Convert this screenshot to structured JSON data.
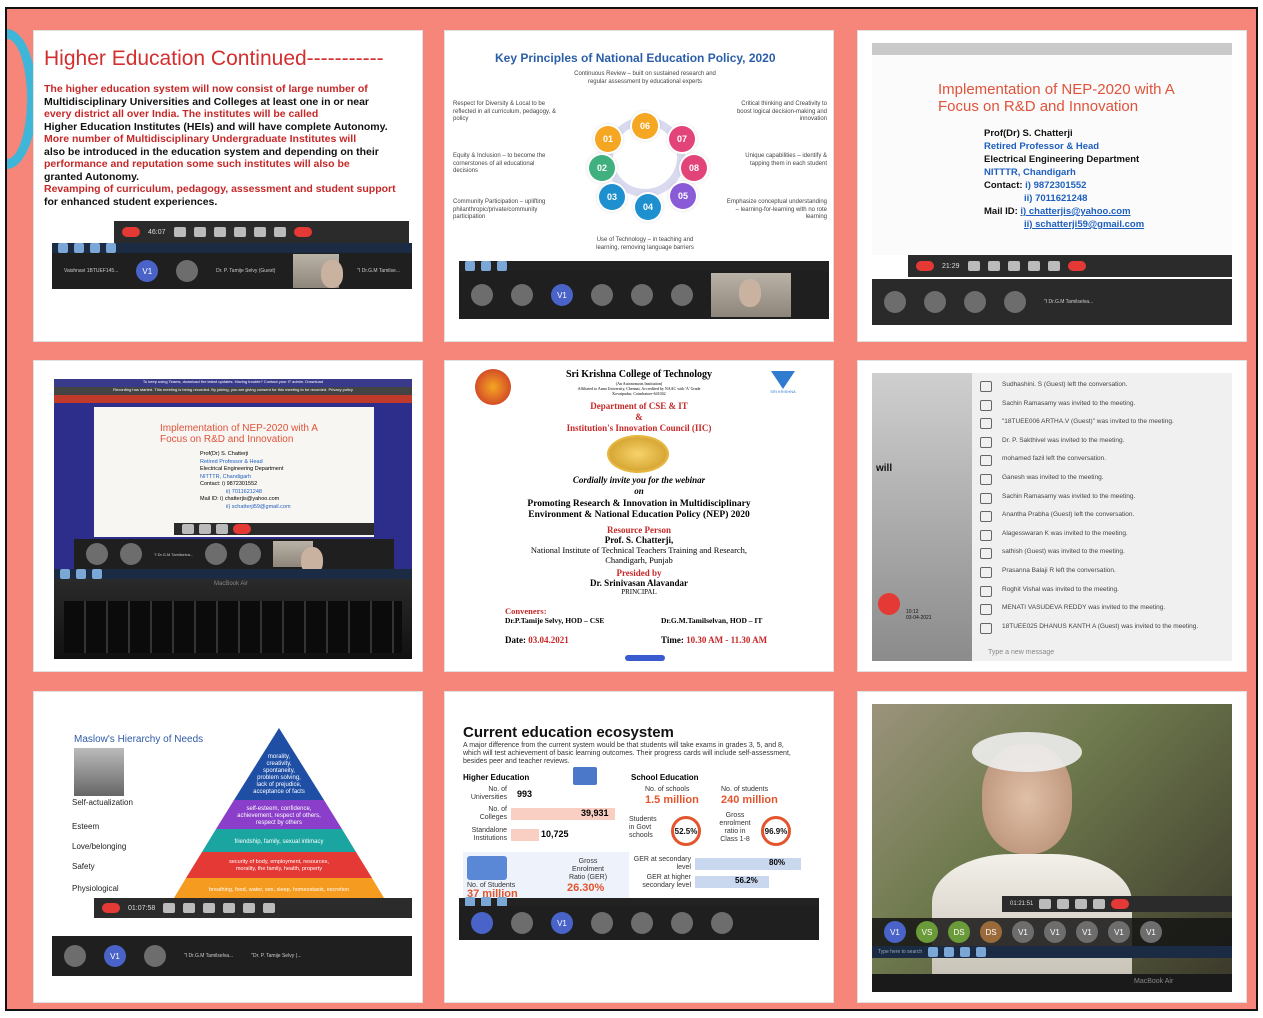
{
  "tile1": {
    "title": "Higher Education Continued-----------",
    "lines": [
      "The higher education system will now consist of large number of",
      "Multidisciplinary Universities and Colleges at least one in or near",
      "every district all over India. The institutes will be called",
      "Higher Education Institutes (HEIs) and will have complete Autonomy.",
      "More number of Multidisciplinary Undergraduate Institutes will",
      "also be introduced in the education system and depending on their",
      "performance and reputation some such institutes will also be",
      "granted Autonomy.",
      "Revamping of curriculum, pedagogy, assessment and student support",
      "for enhanced student experiences."
    ],
    "timer": "46:07",
    "participants": [
      "Vaishnavi 1BTUEF145...",
      "V1",
      "Dr. P. Tamije Selvy (Guest)",
      "\"I Dr.G.M Tamilse..."
    ]
  },
  "tile2": {
    "title": "Key Principles of National Education Policy, 2020",
    "circles": [
      "01",
      "02",
      "03",
      "04",
      "05",
      "06",
      "07",
      "08"
    ],
    "texts": {
      "top": "Continuous Review – built on sustained research and regular assessment by educational experts",
      "tl": "Respect for Diversity & Local to be reflected in all curriculum, pedagogy, & policy",
      "tr": "Critical thinking and Creativity to boost logical decision-making and innovation",
      "ml": "Equity & Inclusion – to become the cornerstones of all educational decisions",
      "mr": "Unique capabilities – identify & tapping them in each student",
      "bl": "Community Participation – uplifting philanthropic/private/community participation",
      "br": "Emphasize conceptual understanding – learning-for-learning with no rote learning",
      "bottom": "Use of Technology – in teaching and learning, removing language barriers"
    },
    "participants": [
      "V1"
    ]
  },
  "tile3": {
    "title": "Implementation of NEP-2020 with A Focus on R&D and Innovation",
    "name": "Prof(Dr) S. Chatterji",
    "role": "Retired Professor & Head",
    "dept": "Electrical Engineering Department",
    "inst": "NITTTR, Chandigarh",
    "contact_label": "Contact:",
    "phone1": "i) 9872301552",
    "phone2": "ii) 7011621248",
    "mail_label": "Mail ID:",
    "mail1": "i) chatterjis@yahoo.com",
    "mail2": "ii) schatterji59@gmail.com",
    "timer": "21:29",
    "participant": "\"I Dr.G.M Tamilselva..."
  },
  "tile4": {
    "notice": "To keep using Teams, download the latest updates. Having trouble? Contact your IT admin. Download",
    "recording": "Recording has started. This meeting is being recorded. By joining, you are giving consent for this meeting to be recorded. Privacy policy",
    "title": "Implementation of NEP-2020 with A Focus on R&D and Innovation",
    "name": "Prof(Dr) S. Chatterji",
    "role": "Retired Professor & Head",
    "dept": "Electrical Engineering Department",
    "inst": "NITTTR, Chandigarh",
    "contact": "Contact: i) 9872301552",
    "phone2": "ii) 7011621248",
    "mail": "Mail ID: i) chatterjis@yahoo.com",
    "mail2": "ii) schatterji59@gmail.com",
    "participant": "\"I Dr.G.M Tamilselva...",
    "laptop": "MacBook Air"
  },
  "tile5": {
    "college": "Sri Krishna College of Technology",
    "college_sub1": "(An Autonomous Institution)",
    "college_sub2": "Affiliated to Anna University, Chennai, Accredited by NAAC with 'A' Grade",
    "college_sub3": "Kovaipudur, Coimbatore-641042",
    "dept": "Department of CSE & IT",
    "amp": "&",
    "iic": "Institution's Innovation Council (IIC)",
    "invite": "Cordially invite you for the webinar",
    "on": "on",
    "topic1": "Promoting Research & Innovation in Multidisciplinary",
    "topic2": "Environment & National Education Policy (NEP) 2020",
    "rp_label": "Resource Person",
    "rp_name": "Prof. S. Chatterji,",
    "rp_inst1": "National Institute of Technical Teachers Training and Research,",
    "rp_inst2": "Chandigarh, Punjab",
    "pres_label": "Presided by",
    "pres_name": "Dr. Srinivasan Alavandar",
    "pres_role": "PRINCIPAL",
    "conv_label": "Conveners:",
    "conv1": "Dr.P.Tamije Selvy, HOD – CSE",
    "conv2": "Dr.G.M.Tamilselvan, HOD – IT",
    "date_label": "Date:",
    "date": "03.04.2021",
    "time_label": "Time:",
    "time": "10.30 AM - 11.30 AM",
    "logo_right": "SRI KRISHNA"
  },
  "tile6": {
    "side": "will",
    "messages": [
      "Sudhashini. S (Guest) left the conversation.",
      "Sachin Ramasamy was invited to the meeting.",
      "\"18TUEE006 ARTHA.V (Guest)\" was invited to the meeting.",
      "Dr. P. Sakthivel was invited to the meeting.",
      "mohamed fazil left the conversation.",
      "Ganesh was invited to the meeting.",
      "Sachin Ramasamy was invited to the meeting.",
      "Anantha Prabha (Guest) left the conversation.",
      "Alagesswaran K was invited to the meeting.",
      "sathish (Guest) was invited to the meeting.",
      "Prasanna Balaji R left the conversation.",
      "Roghit Vishal was invited to the meeting.",
      "MENATI VASUDEVA REDDY was invited to the meeting.",
      "18TUEE025 DHANUS KANTH A (Guest) was invited to the meeting."
    ],
    "compose": "Type a new message",
    "clock": "10:12",
    "date": "03-04-2021"
  },
  "tile7": {
    "title": "Maslow's Hierarchy of Needs",
    "levels": [
      {
        "label": "Self-actualization",
        "text": "morality, creativity, spontaneity, problem solving, lack of prejudice, acceptance of facts",
        "color": "#1f4fa5"
      },
      {
        "label": "Esteem",
        "text": "self-esteem, confidence, achievement, respect of others, respect by others",
        "color": "#8a3ec9"
      },
      {
        "label": "Love/belonging",
        "text": "friendship, family, sexual intimacy",
        "color": "#1aa5a0"
      },
      {
        "label": "Safety",
        "text": "security of body, employment, resources, morality, the family, health, property",
        "color": "#e53935"
      },
      {
        "label": "Physiological",
        "text": "breathing, food, water, sex, sleep, homeostasis, excretion",
        "color": "#f59b1f"
      }
    ],
    "timer": "01:07:58",
    "participants": [
      "V1",
      "\"I Dr.G.M Tamilselva...",
      "\"Dr. P. Tamije Selvy (..."
    ]
  },
  "tile8": {
    "title": "Current education ecosystem",
    "desc": "A major difference from the current system would be that students will take exams in grades 3, 5, and 8, which will test achievement of basic learning outcomes. Their progress cards will include self-assessment, besides peer and teacher reviews.",
    "he_label": "Higher Education",
    "se_label": "School Education",
    "univ_label": "No. of Universities",
    "univ": "993",
    "coll_label": "No. of Colleges",
    "coll": "39,931",
    "standalone_label": "Standalone Institutions",
    "standalone": "10,725",
    "schools_label": "No. of schools",
    "schools": "1.5 million",
    "students_label": "No. of students",
    "students": "240 million",
    "govt_label": "Students in Govt schools",
    "govt": "52.5%",
    "ger18_label": "Gross enrolment ratio in Class 1-8",
    "ger18": "96.9%",
    "ger_sec_label": "GER at secondary level",
    "ger_sec": "80%",
    "ger_hsec_label": "GER at higher secondary level",
    "ger_hsec": "56.2%",
    "he_students_label": "No. of Students",
    "he_students": "37 million",
    "ger_he_label": "Gross Enrolment Ratio (GER)",
    "ger_he": "26.30%",
    "participants": [
      "V1"
    ]
  },
  "tile9": {
    "timer": "01:21:51",
    "participants": [
      "V1",
      "VS",
      "DS",
      "DS",
      "V1",
      "V1",
      "V1",
      "V1",
      "V1"
    ],
    "search": "Type here to search",
    "laptop": "MacBook Air"
  }
}
